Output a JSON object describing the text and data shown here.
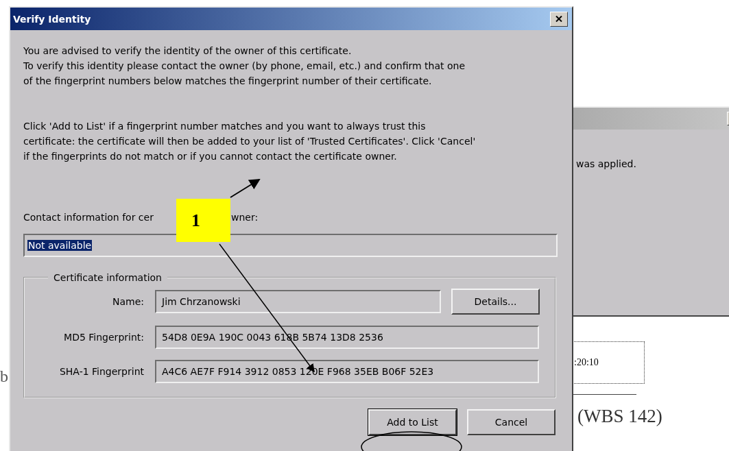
{
  "document": {
    "left_fragment": "b",
    "time_box": ":20:10",
    "heading_fragment": "(WBS 142)"
  },
  "back_dialog": {
    "text": "was applied."
  },
  "dialog": {
    "title": "Verify Identity",
    "paragraphs": [
      [
        "You are advised to verify the identity of the owner of this certificate.",
        "To verify this identity please contact the owner (by phone, email, etc.) and confirm that one",
        "of the fingerprint numbers below matches the fingerprint number of their certificate."
      ],
      [
        "Click 'Add to List' if a fingerprint number matches and you want to always trust this",
        "certificate: the certificate will then be added to your list of 'Trusted Certificates'. Click 'Cancel'",
        "if the fingerprints do not match or if you cannot contact the certificate owner."
      ]
    ],
    "contact_label_start": "Contact information for cer",
    "contact_label_end": "wner:",
    "contact_field": {
      "value": "Not available",
      "selected": true
    },
    "group_title": "Certificate information",
    "rows": [
      {
        "label": "Name:",
        "value": "Jim Chrzanowski",
        "button": "Details..."
      },
      {
        "label": "MD5 Fingerprint:",
        "value": "54D8 0E9A 190C 0043 618B 5B74 13D8 2536"
      },
      {
        "label": "SHA-1 Fingerprint",
        "value": "A4C6 AE7F F914 3912 0853 120E F968 35EB B06F 52E3"
      }
    ],
    "buttons": [
      {
        "label": "Add to List",
        "default": true
      },
      {
        "label": "Cancel",
        "default": false
      }
    ]
  },
  "annotation": {
    "callout": "1"
  }
}
